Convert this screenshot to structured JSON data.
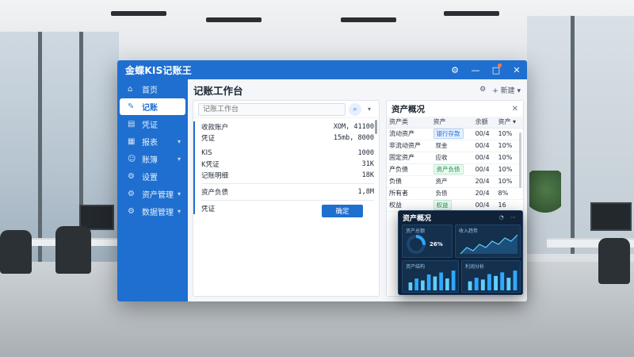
{
  "app": {
    "title": "金蝶KIS记账王",
    "controls": {
      "settings_icon": "settings-icon",
      "minimize": "—",
      "maximize": "□",
      "close": "✕"
    }
  },
  "sidebar": {
    "items": [
      {
        "label": "首页",
        "icon": "home-icon",
        "has_arrow": false
      },
      {
        "label": "记账",
        "icon": "edit-icon",
        "has_arrow": false,
        "active": true
      },
      {
        "label": "凭证",
        "icon": "voucher-icon",
        "has_arrow": false
      },
      {
        "label": "报表",
        "icon": "chart-icon",
        "has_arrow": true
      },
      {
        "label": "账簿",
        "icon": "user-icon",
        "has_arrow": true
      },
      {
        "label": "设置",
        "icon": "gear-icon",
        "has_arrow": false
      },
      {
        "label": "资产管理",
        "icon": "gear-icon",
        "has_arrow": true
      },
      {
        "label": "数据管理",
        "icon": "gear-icon",
        "has_arrow": true
      }
    ]
  },
  "main": {
    "title": "记账工作台",
    "tools": {
      "settings_icon": "settings-icon",
      "add_label": "+ 新建 ▾"
    }
  },
  "ledger": {
    "search_placeholder": "记账工作台",
    "entries": [
      {
        "label": "收款账户",
        "value": "XOM, 41100"
      },
      {
        "label": "凭证",
        "value": "15mb, 8000"
      },
      {
        "label": "KIS",
        "value": "1000"
      },
      {
        "label": "K凭证",
        "value": "31K"
      },
      {
        "label": "记账明细",
        "value": "18K"
      },
      {
        "label": "资产负债",
        "value": "1,8M"
      },
      {
        "label": "凭证",
        "value": ""
      }
    ],
    "confirm_label": "确定"
  },
  "assets": {
    "title": "资产概况",
    "columns": [
      "资产类",
      "资产",
      "余额",
      "资产 ▾"
    ],
    "rows": [
      {
        "name": "流动资产",
        "tag": "银行存款",
        "tag_style": "blue",
        "amount": "00/4",
        "pct": "10%"
      },
      {
        "name": "非流动资产",
        "tag": "现金",
        "tag_style": "none",
        "amount": "00/4",
        "pct": "10%"
      },
      {
        "name": "固定资产",
        "tag": "应收",
        "tag_style": "none",
        "amount": "00/4",
        "pct": "10%"
      },
      {
        "name": "产负债",
        "tag": "资产负债",
        "tag_style": "green",
        "amount": "00/4",
        "pct": "10%"
      },
      {
        "name": "负债",
        "tag": "资产",
        "tag_style": "none",
        "amount": "20/4",
        "pct": "10%"
      },
      {
        "name": "所有者",
        "tag": "负债",
        "tag_style": "none",
        "amount": "20/4",
        "pct": "8%"
      },
      {
        "name": "权益",
        "tag": "权益",
        "tag_style": "green",
        "amount": "00/4",
        "pct": "16"
      }
    ]
  },
  "dashboard": {
    "title": "资产概况",
    "card_labels": [
      "资产总额",
      "收入趋势",
      "资产结构",
      "利润分析"
    ],
    "donut_value": "26%",
    "line_values": [
      3,
      5,
      4,
      6,
      5,
      7,
      6,
      8,
      7,
      9
    ],
    "bar_values": [
      4,
      6,
      5,
      8,
      7,
      9,
      6,
      10
    ],
    "bar_values_b": [
      5,
      7,
      6,
      9,
      8,
      10,
      7,
      11
    ],
    "accent": "#2fa8ff",
    "accent_2": "#5fd0ff"
  },
  "colors": {
    "brand": "#1f6fd0",
    "sidebar": "#1f6fd0",
    "dashboard_bg": "#0f2238"
  }
}
